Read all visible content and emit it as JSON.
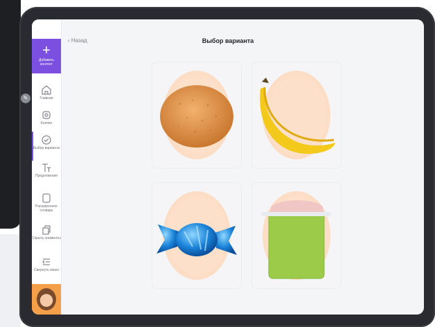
{
  "header": {
    "back_label": "Назад",
    "title": "Выбор варианта"
  },
  "sidebar": {
    "add_button_label": "Добавить контент",
    "items": [
      {
        "label": "Главная",
        "icon": "home-icon"
      },
      {
        "label": "Кнопки",
        "icon": "buttons-icon"
      },
      {
        "label": "Выбор варианта",
        "icon": "choice-icon"
      },
      {
        "label": "Предложения",
        "icon": "text-icon"
      },
      {
        "label": "Расширенное словарь",
        "icon": "tablet-icon"
      },
      {
        "label": "Скрыть элементы",
        "icon": "hide-icon"
      },
      {
        "label": "Свернуть меню",
        "icon": "collapse-menu-icon"
      }
    ],
    "active_index": 2
  },
  "options": [
    {
      "name": "cookie"
    },
    {
      "name": "banana"
    },
    {
      "name": "candy"
    },
    {
      "name": "yogurt"
    }
  ],
  "colors": {
    "accent": "#7b4fe0",
    "avatar_bg": "#f4a04a"
  }
}
